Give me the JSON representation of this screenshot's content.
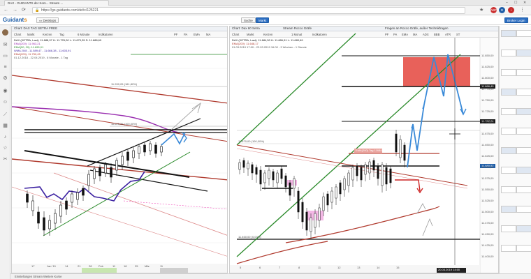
{
  "browser": {
    "tab_title": "DAX - GUIDANTS der Kom... Stream ...",
    "url": "https://go.guidants.com/de#c/125221",
    "ext_icons": [
      "ABP",
      "G",
      "i"
    ]
  },
  "app": {
    "logo_main": "Guidant",
    "logo_accent": "s",
    "desktop_label": "Desktops",
    "header_buttons": [
      "Suche",
      "Markt"
    ],
    "broker_button": "Broker Login"
  },
  "left_chart": {
    "pane_title": "Chart: DAX TAG SETRA FREE",
    "toolbar": [
      "Chart",
      "Markt",
      "Kerzen",
      "Tag",
      "6 Monate",
      "Indikatoren"
    ],
    "toolbar_right": [
      "PF",
      "PA",
      "EMA",
      "MA"
    ],
    "legend": [
      "DAX (XETRA, Last): 11.688,97  H: 11.725,00  L: 11.670,35  S: 11.688,69",
      "EMA(200): 11.963,21",
      "EMA(50, 20): 11.695,01",
      "WMA 20/8 - 11.589,47 - 11.666,38 - 11.603,91",
      "EMA(200): 11.750,45",
      "01.12.2018 - 22.04.2019 - 6 Monate - 1 Tag"
    ],
    "annot_top": "11.990,26 (161,80%)",
    "annot_mid": "11.625,36 (100,00%)",
    "x_ticks": [
      "17",
      "Jan '19",
      "14",
      "21",
      "28",
      "Feb",
      "11",
      "18",
      "25",
      "Mär",
      "11"
    ]
  },
  "right_chart": {
    "pane_title": "Chart: Dax 60 Setra",
    "toolbar": [
      "Chart",
      "Markt",
      "Kerzen",
      "1 Monat",
      "Indikatoren"
    ],
    "toolbar_right": [
      "PF",
      "PA",
      "EMA",
      "MA",
      "ADX",
      "BBB",
      "ATR",
      "ST"
    ],
    "legend": [
      "DAX (XETRA, Last): 11.684,50  H: 11.686,91  L: 11.680,69",
      "EMA(200): 11.648,17",
      "01.03.2019 17:00 - 22.03.2019 16:00 - 3 Wochen - 1 Stunde"
    ],
    "ema_label": "EMA(200) Tag 11684",
    "annot_top": "11.670,00 (100,00%)",
    "annot_bottom": "11.460,00 (0,00%)",
    "x_ticks": [
      "5",
      "6",
      "7",
      "8",
      "11",
      "12",
      "13",
      "14",
      "15"
    ],
    "crosshair_date": "20.03.2019 14:00",
    "price_tags": [
      {
        "label": "11.866,40",
        "color": "#1a1a1a"
      },
      {
        "label": "11.762,24",
        "color": "#1a1a1a"
      },
      {
        "label": "11.680,52",
        "color": "#1f5ea8"
      }
    ],
    "y_ticks": [
      "11.850,00",
      "11.825,00",
      "11.800,00",
      "11.775,00",
      "11.750,00",
      "11.725,00",
      "11.700,00",
      "11.675,00",
      "11.650,00",
      "11.625,00",
      "11.600,00",
      "11.575,00",
      "11.550,00",
      "11.525,00",
      "11.500,00",
      "11.475,00",
      "11.450,00",
      "11.425,00",
      "11.400,00"
    ]
  },
  "side": {
    "stream_title": "Stream Rocco Gräfe",
    "questions_title": "Fragen an Rocco Gräfe, außer Technikfragen"
  },
  "statusbar": "Einstellungen Stream Weitere Kurse"
}
